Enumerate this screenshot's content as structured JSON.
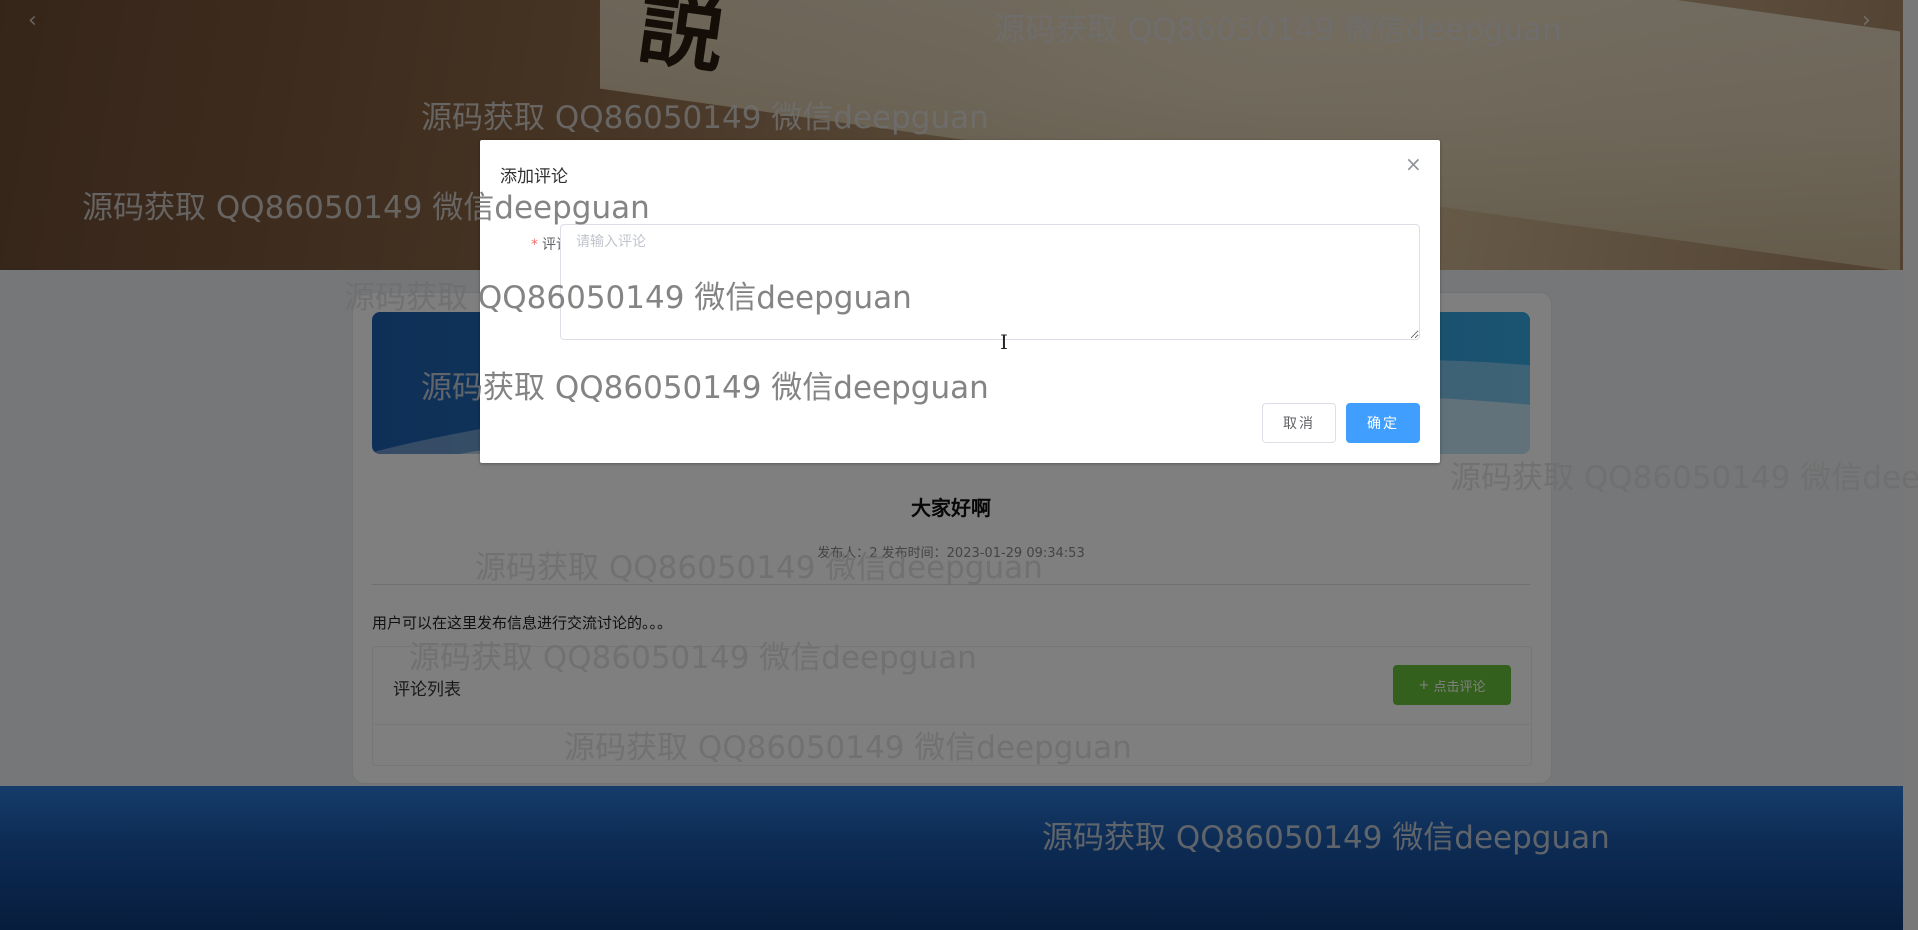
{
  "carousel": {
    "prev_icon": "‹",
    "next_icon": "›"
  },
  "post": {
    "title": "大家好啊",
    "meta": "发布人：2  发布时间：2023-01-29 09:34:53",
    "body": "用户可以在这里发布信息进行交流讨论的。。。"
  },
  "comments": {
    "title": "评论列表",
    "add_button_label": "点击评论",
    "add_button_icon": "+"
  },
  "dialog": {
    "title": "添加评论",
    "close_icon": "×",
    "field_label": "评论",
    "required_mark": "*",
    "placeholder": "请输入评论",
    "value": "",
    "cancel_label": "取消",
    "confirm_label": "确定"
  },
  "watermark": {
    "text": "源码获取 QQ86050149 微信deepguan"
  },
  "colors": {
    "primary": "#409eff",
    "success": "#67c23a",
    "required": "#f56c6c"
  }
}
